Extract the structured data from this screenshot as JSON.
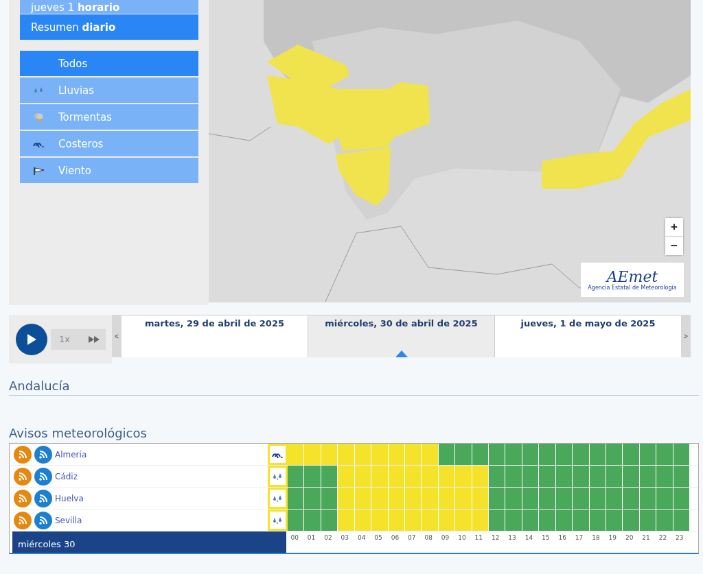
{
  "view_modes": [
    {
      "label": "jueves 1 **horario**",
      "selected": false
    },
    {
      "label": "Resumen **diario**",
      "selected": true
    }
  ],
  "phenomena": [
    {
      "label": "Todos",
      "kind": "all",
      "selected": true
    },
    {
      "label": "Lluvias",
      "kind": "rain",
      "selected": false
    },
    {
      "label": "Tormentas",
      "kind": "storm",
      "selected": false
    },
    {
      "label": "Costeros",
      "kind": "coastal",
      "selected": false
    },
    {
      "label": "Viento",
      "kind": "wind",
      "selected": false
    }
  ],
  "map": {
    "zoom_in": "+",
    "zoom_out": "−",
    "logo": "AEmet",
    "logo_caption": "Agencia Estatal de Meteorología"
  },
  "player": {
    "speed": "1x"
  },
  "days": [
    {
      "label": "martes, 29 de abril de 2025",
      "selected": false
    },
    {
      "label": "miércoles, 30 de abril de 2025",
      "selected": true
    },
    {
      "label": "jueves, 1 de mayo de 2025",
      "selected": false
    }
  ],
  "day_nav": {
    "prev": "<",
    "next": ">"
  },
  "region_title": "Andalucía",
  "warnings_title": "Avisos meteorológicos",
  "warnings": [
    {
      "name": "Almeria",
      "kind": "coastal",
      "cells": [
        {
          "color": "#f5e22a"
        },
        {
          "color": "#f5e22a"
        },
        {
          "color": "#f5e22a"
        },
        {
          "color": "#f5e22a"
        },
        {
          "color": "#f5e22a"
        },
        {
          "color": "#f5e22a"
        },
        {
          "color": "#f5e22a"
        },
        {
          "color": "#f5e22a"
        },
        {
          "color": "#f5e22a"
        },
        {
          "color": "#4aa85a"
        },
        {
          "color": "#4aa85a"
        },
        {
          "color": "#4aa85a"
        },
        {
          "color": "#4aa85a"
        },
        {
          "color": "#4aa85a"
        },
        {
          "color": "#4aa85a"
        },
        {
          "color": "#4aa85a"
        },
        {
          "color": "#4aa85a"
        },
        {
          "color": "#4aa85a"
        },
        {
          "color": "#4aa85a"
        },
        {
          "color": "#4aa85a"
        },
        {
          "color": "#4aa85a"
        },
        {
          "color": "#4aa85a"
        },
        {
          "color": "#4aa85a"
        },
        {
          "color": "#4aa85a"
        }
      ]
    },
    {
      "name": "Cádiz",
      "kind": "rain",
      "cells": [
        {
          "color": "#4aa85a"
        },
        {
          "color": "#4aa85a"
        },
        {
          "color": "#4aa85a"
        },
        {
          "color": "#f5e22a"
        },
        {
          "color": "#f5e22a"
        },
        {
          "color": "#f5e22a"
        },
        {
          "color": "#f5e22a"
        },
        {
          "color": "#f5e22a"
        },
        {
          "color": "#f5e22a"
        },
        {
          "color": "#f5e22a"
        },
        {
          "color": "#f5e22a"
        },
        {
          "color": "#f5e22a"
        },
        {
          "color": "#4aa85a"
        },
        {
          "color": "#4aa85a"
        },
        {
          "color": "#4aa85a"
        },
        {
          "color": "#4aa85a"
        },
        {
          "color": "#4aa85a"
        },
        {
          "color": "#4aa85a"
        },
        {
          "color": "#4aa85a"
        },
        {
          "color": "#4aa85a"
        },
        {
          "color": "#4aa85a"
        },
        {
          "color": "#4aa85a"
        },
        {
          "color": "#4aa85a"
        },
        {
          "color": "#4aa85a"
        }
      ]
    },
    {
      "name": "Huelva",
      "kind": "rain",
      "cells": [
        {
          "color": "#4aa85a"
        },
        {
          "color": "#4aa85a"
        },
        {
          "color": "#4aa85a"
        },
        {
          "color": "#f5e22a"
        },
        {
          "color": "#f5e22a"
        },
        {
          "color": "#f5e22a"
        },
        {
          "color": "#f5e22a"
        },
        {
          "color": "#f5e22a"
        },
        {
          "color": "#f5e22a"
        },
        {
          "color": "#f5e22a"
        },
        {
          "color": "#f5e22a"
        },
        {
          "color": "#f5e22a"
        },
        {
          "color": "#4aa85a"
        },
        {
          "color": "#4aa85a"
        },
        {
          "color": "#4aa85a"
        },
        {
          "color": "#4aa85a"
        },
        {
          "color": "#4aa85a"
        },
        {
          "color": "#4aa85a"
        },
        {
          "color": "#4aa85a"
        },
        {
          "color": "#4aa85a"
        },
        {
          "color": "#4aa85a"
        },
        {
          "color": "#4aa85a"
        },
        {
          "color": "#4aa85a"
        },
        {
          "color": "#4aa85a"
        }
      ]
    },
    {
      "name": "Sevilla",
      "kind": "rain",
      "cells": [
        {
          "color": "#4aa85a"
        },
        {
          "color": "#4aa85a"
        },
        {
          "color": "#4aa85a"
        },
        {
          "color": "#f5e22a"
        },
        {
          "color": "#f5e22a"
        },
        {
          "color": "#f5e22a"
        },
        {
          "color": "#f5e22a"
        },
        {
          "color": "#f5e22a"
        },
        {
          "color": "#f5e22a"
        },
        {
          "color": "#f5e22a"
        },
        {
          "color": "#f5e22a"
        },
        {
          "color": "#f5e22a"
        },
        {
          "color": "#4aa85a"
        },
        {
          "color": "#4aa85a"
        },
        {
          "color": "#4aa85a"
        },
        {
          "color": "#4aa85a"
        },
        {
          "color": "#4aa85a"
        },
        {
          "color": "#4aa85a"
        },
        {
          "color": "#4aa85a"
        },
        {
          "color": "#4aa85a"
        },
        {
          "color": "#4aa85a"
        },
        {
          "color": "#4aa85a"
        },
        {
          "color": "#4aa85a"
        },
        {
          "color": "#4aa85a"
        }
      ]
    }
  ],
  "table_day": "miércoles 30",
  "hours": [
    "00",
    "01",
    "02",
    "03",
    "04",
    "05",
    "06",
    "07",
    "08",
    "09",
    "10",
    "11",
    "12",
    "13",
    "14",
    "15",
    "16",
    "17",
    "18",
    "19",
    "20",
    "21",
    "22",
    "23"
  ]
}
